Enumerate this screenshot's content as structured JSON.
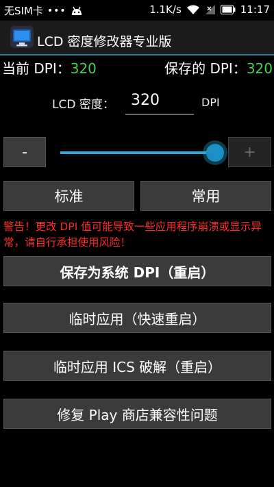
{
  "status_bar": {
    "carrier": "无SIM卡",
    "dots": "•••",
    "speed": "1.1K/s",
    "time": "11:17"
  },
  "action_bar": {
    "title": "LCD 密度修改器专业版",
    "icon": "monitor-icon"
  },
  "dpi_info": {
    "current_label": "当前 DPI：",
    "current_value": "320",
    "saved_label": "保存的 DPI：",
    "saved_value": "320"
  },
  "lcd_density": {
    "label": "LCD 密度：",
    "value": "320",
    "unit": "DPI"
  },
  "slider": {
    "minus_label": "-",
    "plus_label": "+",
    "level": 0.95
  },
  "presets": {
    "standard_label": "标准",
    "common_label": "常用"
  },
  "warning_text": "警告！更改 DPI 值可能导致一些应用程序崩溃或显示异常，请自行承担使用风险！",
  "actions": {
    "save_label": "保存为系统 DPI（重启）",
    "quick_label": "临时应用（快速重启）",
    "ics_label": "临时应用 ICS 破解（重启）",
    "play_label": "修复 Play 商店兼容性问题"
  },
  "colors": {
    "accent": "#2ea8d8",
    "value_green": "#4bd24b",
    "warning_red": "#ff2a2a"
  }
}
